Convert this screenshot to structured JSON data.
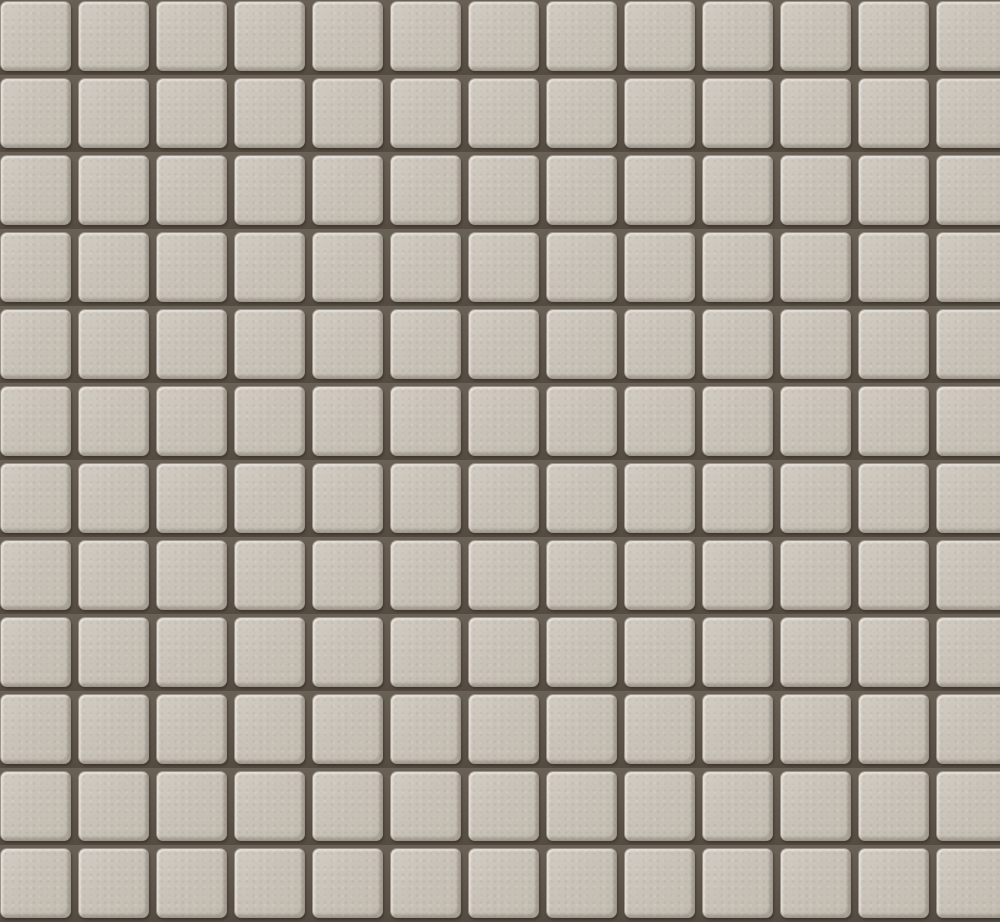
{
  "mosaic": {
    "rows": 12,
    "columns": 13,
    "tile_color": "#c9c3b9",
    "grout_color": "#5a5147",
    "highlight_color": "#e3ded6"
  }
}
